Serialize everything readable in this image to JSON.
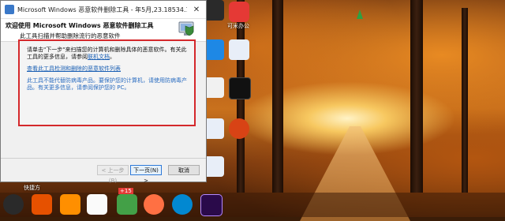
{
  "window": {
    "title": "Microsoft Windows 恶意软件删除工具 - 年5月,23.18534.1",
    "header_title": "欢迎使用 Microsoft Windows 恶意软件删除工具",
    "header_subtitle": "此工具扫描并帮助删除流行的恶意软件",
    "paragraph1_text": "请单击\"下一步\"来扫描您的计算机和删除具体的恶意软件。有关此工具的更多信息，请参阅",
    "paragraph1_link": "联机文档",
    "link_list": "查看此工具检测和删除的恶意软件列表",
    "paragraph2": "此工具不能代替防病毒产品。要保护您的计算机，请使用防病毒产品。有关更多信息，请参阅保护您的 PC。",
    "buttons": {
      "back": "< 上一步(B)",
      "next": "下一页(N) >",
      "cancel": "取消"
    }
  },
  "desktop": {
    "label_1": "可米办公",
    "label_2": "快捷方",
    "badge": "+15"
  },
  "colors": {
    "highlight_border": "#d4282b",
    "link": "#1a5fb4",
    "info_text": "#2a6cc0"
  }
}
